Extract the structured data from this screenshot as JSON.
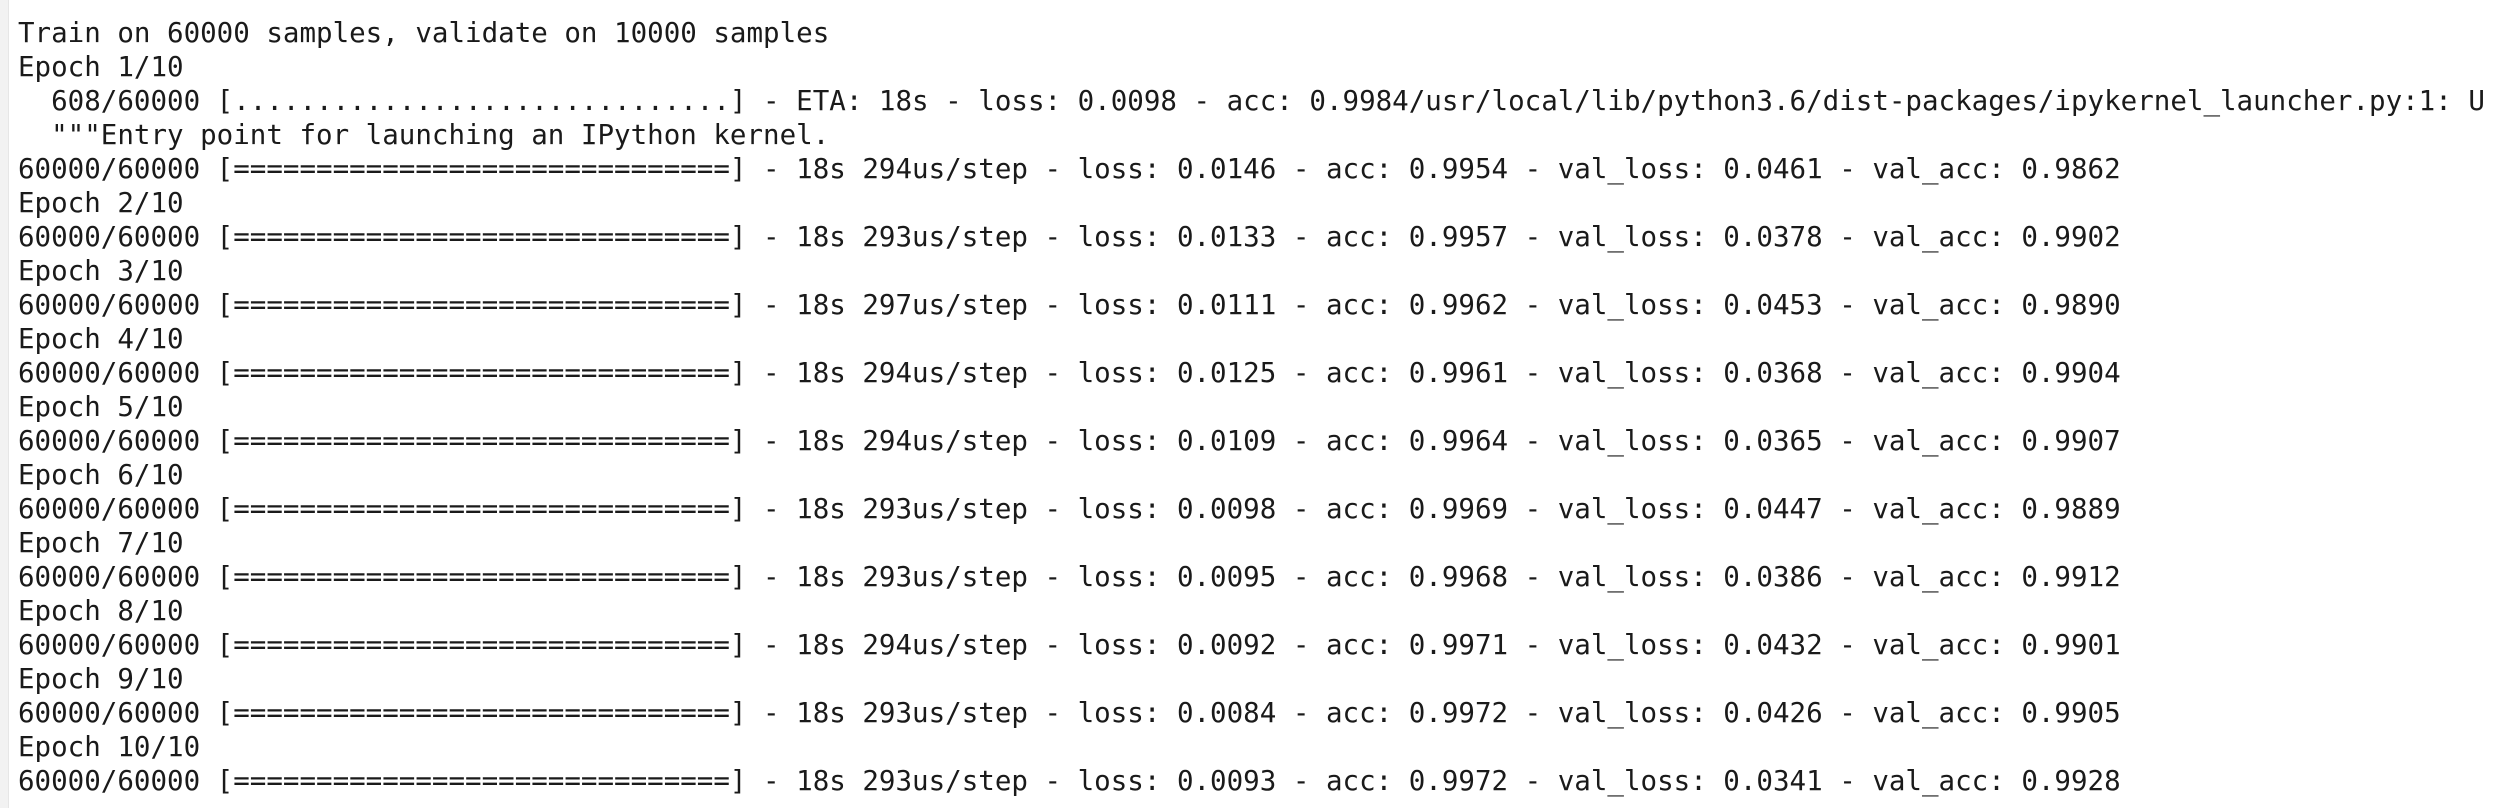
{
  "output": {
    "lines": [
      "Train on 60000 samples, validate on 10000 samples",
      "Epoch 1/10",
      "  608/60000 [..............................] - ETA: 18s - loss: 0.0098 - acc: 0.9984/usr/local/lib/python3.6/dist-packages/ipykernel_launcher.py:1: U",
      "  \"\"\"Entry point for launching an IPython kernel.",
      "60000/60000 [==============================] - 18s 294us/step - loss: 0.0146 - acc: 0.9954 - val_loss: 0.0461 - val_acc: 0.9862",
      "Epoch 2/10",
      "60000/60000 [==============================] - 18s 293us/step - loss: 0.0133 - acc: 0.9957 - val_loss: 0.0378 - val_acc: 0.9902",
      "Epoch 3/10",
      "60000/60000 [==============================] - 18s 297us/step - loss: 0.0111 - acc: 0.9962 - val_loss: 0.0453 - val_acc: 0.9890",
      "Epoch 4/10",
      "60000/60000 [==============================] - 18s 294us/step - loss: 0.0125 - acc: 0.9961 - val_loss: 0.0368 - val_acc: 0.9904",
      "Epoch 5/10",
      "60000/60000 [==============================] - 18s 294us/step - loss: 0.0109 - acc: 0.9964 - val_loss: 0.0365 - val_acc: 0.9907",
      "Epoch 6/10",
      "60000/60000 [==============================] - 18s 293us/step - loss: 0.0098 - acc: 0.9969 - val_loss: 0.0447 - val_acc: 0.9889",
      "Epoch 7/10",
      "60000/60000 [==============================] - 18s 293us/step - loss: 0.0095 - acc: 0.9968 - val_loss: 0.0386 - val_acc: 0.9912",
      "Epoch 8/10",
      "60000/60000 [==============================] - 18s 294us/step - loss: 0.0092 - acc: 0.9971 - val_loss: 0.0432 - val_acc: 0.9901",
      "Epoch 9/10",
      "60000/60000 [==============================] - 18s 293us/step - loss: 0.0084 - acc: 0.9972 - val_loss: 0.0426 - val_acc: 0.9905",
      "Epoch 10/10",
      "60000/60000 [==============================] - 18s 293us/step - loss: 0.0093 - acc: 0.9972 - val_loss: 0.0341 - val_acc: 0.9928"
    ]
  }
}
